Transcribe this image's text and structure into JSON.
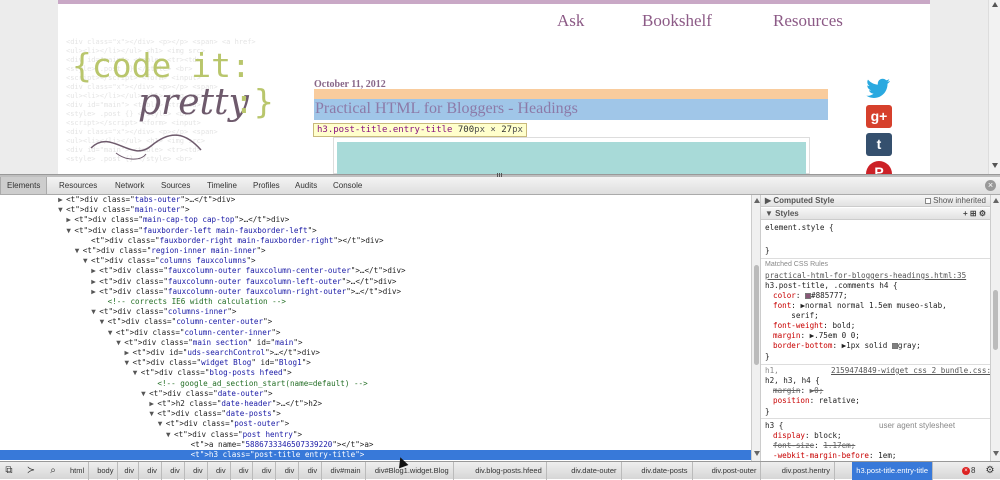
{
  "page": {
    "nav": [
      "Ask",
      "Bookshelf",
      "Resources"
    ],
    "logo_line1": "{code it:",
    "logo_line2": "pretty",
    "logo_line2b": ":}",
    "post_date": "October 11, 2012",
    "post_title": "Practical HTML for Bloggers - Headings",
    "tooltip": {
      "tag": "h3.post-title.entry-title",
      "width": "700",
      "height": "27",
      "unit": "px",
      "times": "×"
    },
    "social": [
      "twitter-icon",
      "google-plus-icon",
      "tumblr-icon",
      "pinterest-icon"
    ],
    "social_labels": {
      "gplus": "g+",
      "tumblr": "t",
      "pinterest": "P"
    }
  },
  "devtools": {
    "tabs": [
      "Elements",
      "Resources",
      "Network",
      "Sources",
      "Timeline",
      "Profiles",
      "Audits",
      "Console"
    ],
    "active_tab": "Elements",
    "dom_rows": [
      {
        "indent": 7,
        "arrow": "▶",
        "html": "<div class=\"tabs-outer\">…</div>"
      },
      {
        "indent": 7,
        "arrow": "▼",
        "html": "<div class=\"main-outer\">"
      },
      {
        "indent": 8,
        "arrow": "▶",
        "html": "<div class=\"main-cap-top cap-top\">…</div>"
      },
      {
        "indent": 8,
        "arrow": "▼",
        "html": "<div class=\"fauxborder-left main-fauxborder-left\">"
      },
      {
        "indent": 10,
        "arrow": "",
        "html": "<div class=\"fauxborder-right main-fauxborder-right\"></div>"
      },
      {
        "indent": 9,
        "arrow": "▼",
        "html": "<div class=\"region-inner main-inner\">"
      },
      {
        "indent": 10,
        "arrow": "▼",
        "html": "<div class=\"columns fauxcolumns\">"
      },
      {
        "indent": 11,
        "arrow": "▶",
        "html": "<div class=\"fauxcolumn-outer fauxcolumn-center-outer\">…</div>"
      },
      {
        "indent": 11,
        "arrow": "▶",
        "html": "<div class=\"fauxcolumn-outer fauxcolumn-left-outer\">…</div>"
      },
      {
        "indent": 11,
        "arrow": "▶",
        "html": "<div class=\"fauxcolumn-outer fauxcolumn-right-outer\">…</div>"
      },
      {
        "indent": 12,
        "arrow": "",
        "html": "<!-- corrects IE6 width calculation -->",
        "comment": true
      },
      {
        "indent": 11,
        "arrow": "▼",
        "html": "<div class=\"columns-inner\">"
      },
      {
        "indent": 12,
        "arrow": "▼",
        "html": "<div class=\"column-center-outer\">"
      },
      {
        "indent": 13,
        "arrow": "▼",
        "html": "<div class=\"column-center-inner\">"
      },
      {
        "indent": 14,
        "arrow": "▼",
        "html": "<div class=\"main section\" id=\"main\">"
      },
      {
        "indent": 15,
        "arrow": "▶",
        "html": "<div id=\"uds-searchControl\">…</div>"
      },
      {
        "indent": 15,
        "arrow": "▼",
        "html": "<div class=\"widget Blog\" id=\"Blog1\">"
      },
      {
        "indent": 16,
        "arrow": "▼",
        "html": "<div class=\"blog-posts hfeed\">"
      },
      {
        "indent": 18,
        "arrow": "",
        "html": "<!-- google_ad_section_start(name=default) -->",
        "comment": true
      },
      {
        "indent": 17,
        "arrow": "▼",
        "html": "<div class=\"date-outer\">"
      },
      {
        "indent": 18,
        "arrow": "▶",
        "html": "<h2 class=\"date-header\">…</h2>"
      },
      {
        "indent": 18,
        "arrow": "▼",
        "html": "<div class=\"date-posts\">"
      },
      {
        "indent": 19,
        "arrow": "▼",
        "html": "<div class=\"post-outer\">"
      },
      {
        "indent": 20,
        "arrow": "▼",
        "html": "<div class=\"post hentry\">"
      },
      {
        "indent": 22,
        "arrow": "",
        "html": "<a name=\"5886733346507339220\"></a>"
      },
      {
        "indent": 22,
        "arrow": "",
        "html": "<h3 class=\"post-title entry-title\">",
        "selected": true
      }
    ],
    "styles": {
      "computed_label": "Computed Style",
      "show_inherited": "Show inherited",
      "styles_label": "Styles",
      "element_style": "element.style {",
      "close_brace": "}",
      "matched_label": "Matched CSS Rules",
      "rule1_source": "practical-html-for-bloggers-headings.html:35",
      "rule1_selector": "h3.post-title, .comments h4 {",
      "rule1_props": [
        {
          "name": "color",
          "value": "#885777;",
          "swatch": "#885777"
        },
        {
          "name": "font",
          "value": "▶normal normal 1.5em museo-slab,"
        },
        {
          "name": "",
          "value": "    serif;"
        },
        {
          "name": "font-weight",
          "value": "bold;"
        },
        {
          "name": "margin",
          "value": "▶.75em 0 0;"
        },
        {
          "name": "border-bottom",
          "value": "▶1px solid ",
          "swatch": "#808080",
          "after": "gray;"
        }
      ],
      "rule2_prefix": "h1,",
      "rule2_source": "2159474849-widget_css_2_bundle.css:1",
      "rule2_selector": "h2, h3, h4 {",
      "rule2_props": [
        {
          "name": "margin",
          "value": "▶0;",
          "strike": true
        },
        {
          "name": "position",
          "value": "relative;"
        }
      ],
      "rule3_selector": "h3 {",
      "rule3_origin": "user agent stylesheet",
      "rule3_props": [
        {
          "name": "display",
          "value": "block;"
        },
        {
          "name": "font-size",
          "value": "1.17em;",
          "strike": true
        },
        {
          "name": "-webkit-margin-before",
          "value": "1em;"
        }
      ]
    },
    "breadcrumbs": [
      "html",
      "body",
      "div",
      "div",
      "div",
      "div",
      "div",
      "div",
      "div",
      "div",
      "div",
      "div#main",
      "div#Blog1.widget.Blog",
      "div.blog-posts.hfeed",
      "div.date-outer",
      "div.date-posts",
      "div.post-outer",
      "div.post.hentry",
      "h3.post-title.entry-title"
    ],
    "error_count": "8"
  }
}
